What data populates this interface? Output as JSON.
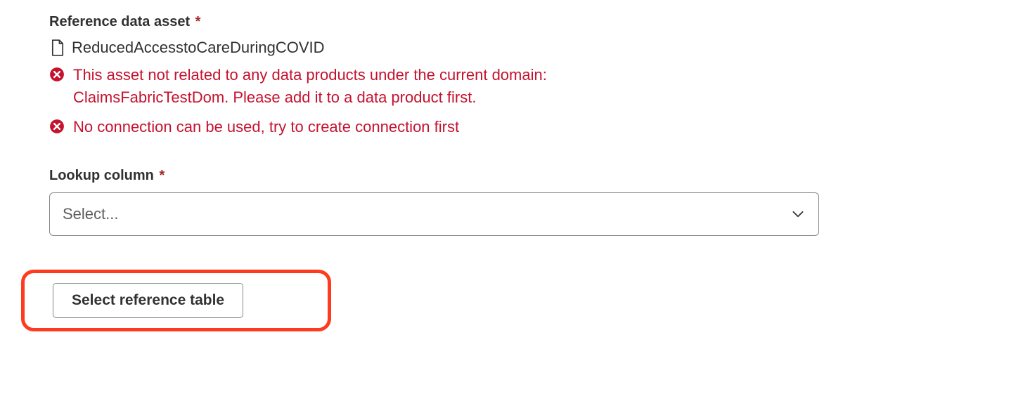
{
  "reference_asset": {
    "label": "Reference data asset",
    "required_mark": "*",
    "asset_name": "ReducedAccesstoCareDuringCOVID",
    "errors": [
      "This asset not related to any data products under the current domain: ClaimsFabricTestDom. Please add it to a data product first.",
      "No connection can be used, try to create connection first"
    ]
  },
  "lookup_column": {
    "label": "Lookup column",
    "required_mark": "*",
    "placeholder": "Select..."
  },
  "actions": {
    "select_reference_table": "Select reference table"
  }
}
